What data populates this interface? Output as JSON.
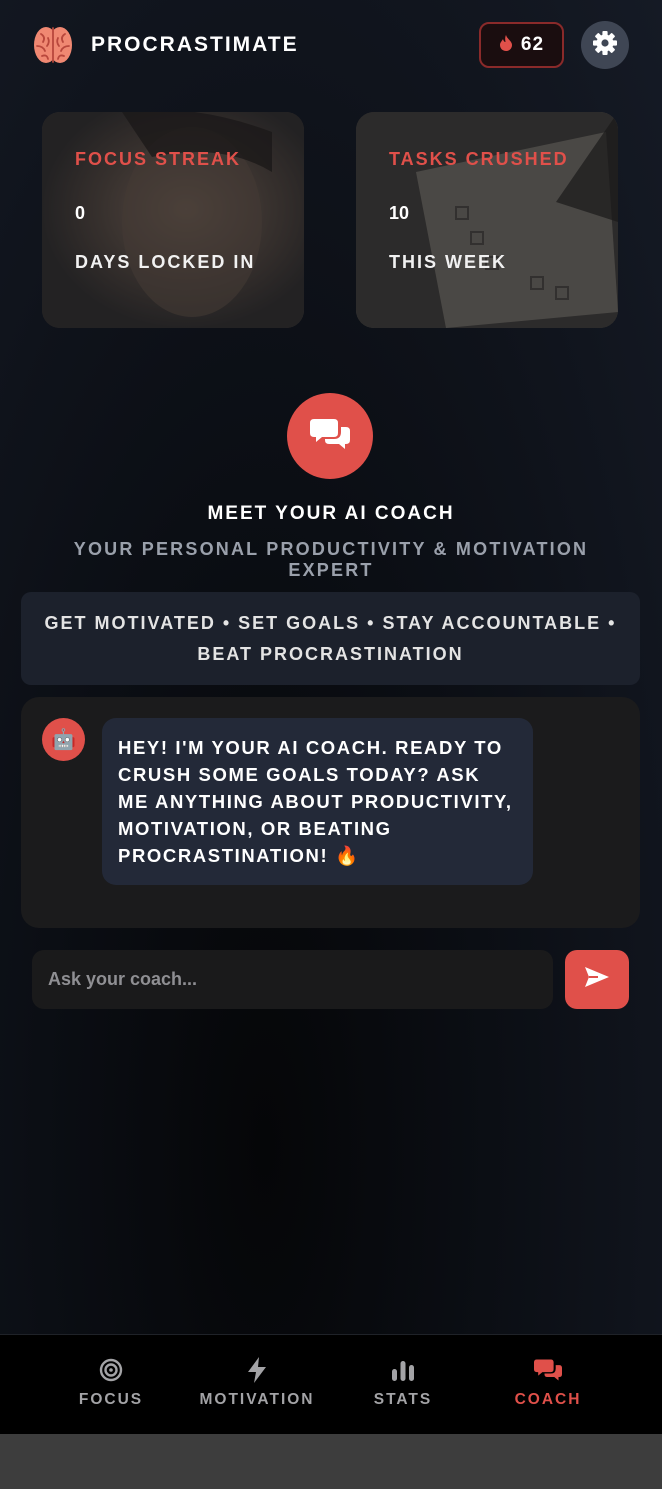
{
  "header": {
    "app_title": "PROCRASTIMATE",
    "streak_count": "62",
    "logo_icon": "brain-icon",
    "streak_icon": "fire-icon",
    "settings_icon": "gear-icon"
  },
  "stats": [
    {
      "label": "FOCUS STREAK",
      "value": "0",
      "sub": "DAYS LOCKED IN"
    },
    {
      "label": "TASKS CRUSHED",
      "value": "10",
      "sub": "THIS WEEK"
    }
  ],
  "coach": {
    "title": "MEET YOUR AI COACH",
    "subtitle": "YOUR PERSONAL PRODUCTIVITY & MOTIVATION EXPERT",
    "tags": "GET MOTIVATED • SET GOALS • STAY ACCOUNTABLE • BEAT PROCRASTINATION"
  },
  "chat": {
    "messages": [
      {
        "sender": "bot",
        "avatar": "🤖",
        "text": "HEY! I'M YOUR AI COACH. READY TO CRUSH SOME GOALS TODAY? ASK ME ANYTHING ABOUT PRODUCTIVITY, MOTIVATION, OR BEATING PROCRASTINATION! 🔥"
      }
    ]
  },
  "input": {
    "placeholder": "Ask your coach...",
    "value": ""
  },
  "nav": {
    "items": [
      {
        "label": "FOCUS",
        "icon": "target-icon",
        "active": false
      },
      {
        "label": "MOTIVATION",
        "icon": "lightning-icon",
        "active": false
      },
      {
        "label": "STATS",
        "icon": "bar-chart-icon",
        "active": false
      },
      {
        "label": "COACH",
        "icon": "chat-bubbles-icon",
        "active": true
      }
    ]
  },
  "colors": {
    "accent": "#e0504a",
    "background": "#0c0f15",
    "card": "#1c212c",
    "chat_bubble": "#232938"
  }
}
